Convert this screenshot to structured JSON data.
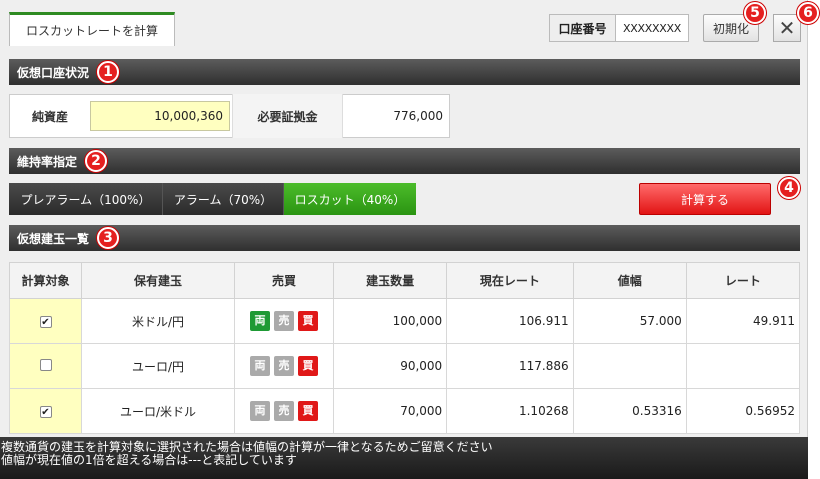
{
  "tab": {
    "label": "ロスカットレートを計算"
  },
  "account": {
    "label": "口座番号",
    "value": "XXXXXXXX"
  },
  "buttons": {
    "init": "初期化",
    "close": "✕",
    "calc": "計算する"
  },
  "badges": {
    "b1": "1",
    "b2": "2",
    "b3": "3",
    "b4": "4",
    "b5": "5",
    "b6": "6"
  },
  "sections": {
    "account_status": "仮想口座状況",
    "maintenance": "維持率指定",
    "positions": "仮想建玉一覧"
  },
  "assets": {
    "net_label": "純資産",
    "net_value": "10,000,360",
    "margin_label": "必要証拠金",
    "margin_value": "776,000"
  },
  "rate_options": [
    "プレアラーム（100%）",
    "アラーム（70%）",
    "ロスカット（40%）"
  ],
  "rate_selected": "ロスカット（40%）",
  "table": {
    "headers": [
      "計算対象",
      "保有建玉",
      "売買",
      "建玉数量",
      "現在レート",
      "値幅",
      "レート"
    ],
    "rows": [
      {
        "checked": "✔",
        "pair": "米ドル/円",
        "both": "両",
        "sell": "売",
        "buy": "買",
        "qty": "100,000",
        "rate": "106.911",
        "range": "57.000",
        "result": "49.911"
      },
      {
        "checked": "",
        "pair": "ユーロ/円",
        "both": "両",
        "sell": "売",
        "buy": "買",
        "qty": "90,000",
        "rate": "117.886",
        "range": "",
        "result": ""
      },
      {
        "checked": "✔",
        "pair": "ユーロ/米ドル",
        "both": "両",
        "sell": "売",
        "buy": "買",
        "qty": "70,000",
        "rate": "1.10268",
        "range": "0.53316",
        "result": "0.56952"
      }
    ]
  },
  "footer": {
    "line1": "複数通貨の建玉を計算対象に選択された場合は値幅の計算が一律となるためご留意ください",
    "line2": "値幅が現在値の1倍を超える場合は---と表記しています"
  }
}
